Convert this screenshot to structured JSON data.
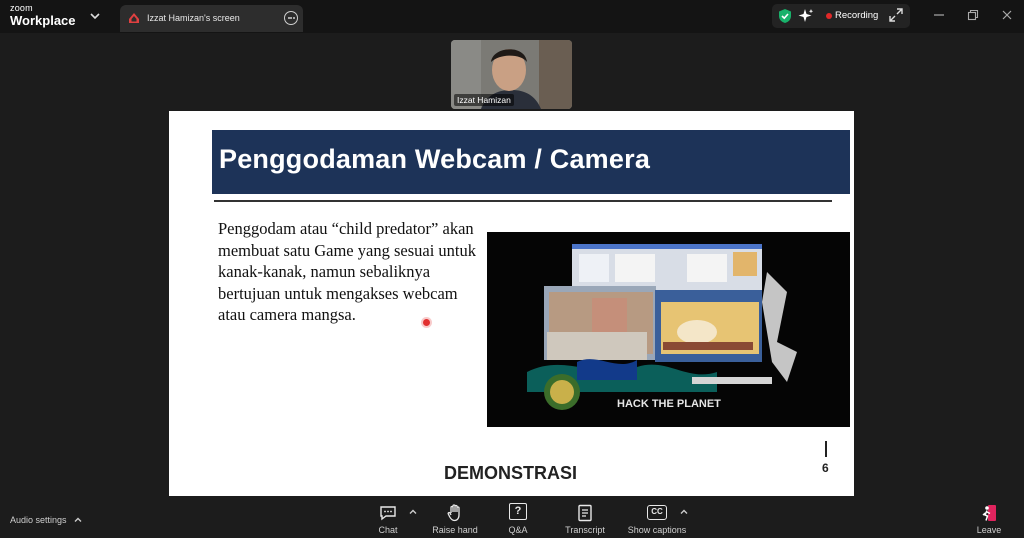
{
  "app": {
    "brand_top": "zoom",
    "brand_bottom": "Workplace"
  },
  "tab": {
    "title": "Izzat Hamizan's screen"
  },
  "status": {
    "recording_label": "Recording",
    "accent": "#e02828",
    "shield_color": "#19b26b"
  },
  "participant": {
    "name": "Izzat Hamizan"
  },
  "slide": {
    "title": "Penggodaman Webcam / Camera",
    "body": "Penggodam atau “child predator” akan membuat satu Game yang sesuai untuk kanak-kanak, namun sebaliknya bertujuan untuk mengakses webcam atau camera mangsa.",
    "image_caption": "HACK THE PLANET",
    "footer": "DEMONSTRASI",
    "page_number": "6",
    "header_color": "#1d3358"
  },
  "toolbar": {
    "audio_settings": "Audio settings",
    "chat": "Chat",
    "raise_hand": "Raise hand",
    "qa": "Q&A",
    "qa_glyph": "?",
    "transcript": "Transcript",
    "show_captions": "Show captions",
    "cc_glyph": "CC",
    "leave": "Leave"
  }
}
